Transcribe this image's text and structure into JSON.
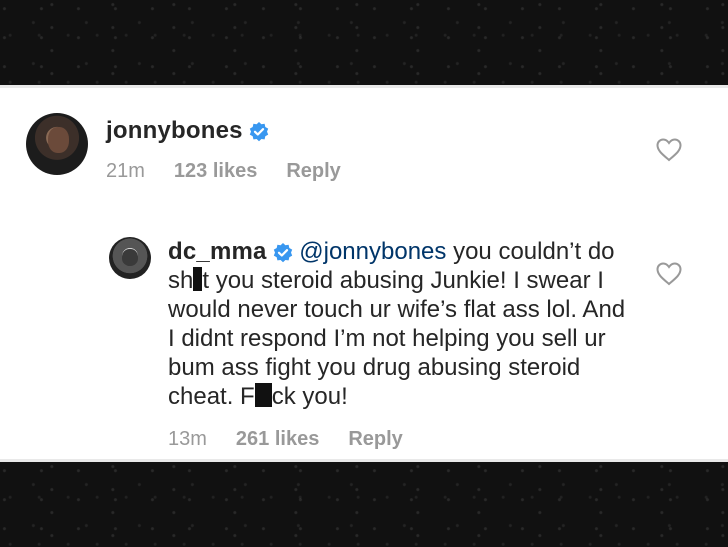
{
  "comment": {
    "username": "jonnybones",
    "time": "21m",
    "likes": "123 likes",
    "reply_label": "Reply",
    "verified_icon": "verified-badge-icon",
    "like_icon": "heart-outline-icon"
  },
  "reply_comment": {
    "username": "dc_mma",
    "mention": "@jonnybones",
    "text_part1": " you couldn’t do sh",
    "text_part2": "t you steroid abusing Junkie! I swear I would never touch ur wife’s flat ass lol. And I didnt respond I’m not helping you sell ur bum ass fight you drug abusing steroid cheat. F",
    "text_part3": "ck you!",
    "time": "13m",
    "likes": "261 likes",
    "reply_label": "Reply",
    "verified_icon": "verified-badge-icon",
    "like_icon": "heart-outline-icon"
  },
  "colors": {
    "verified_blue": "#3897f0",
    "mention_blue": "#003569",
    "meta_gray": "#999999",
    "text": "#262626"
  }
}
